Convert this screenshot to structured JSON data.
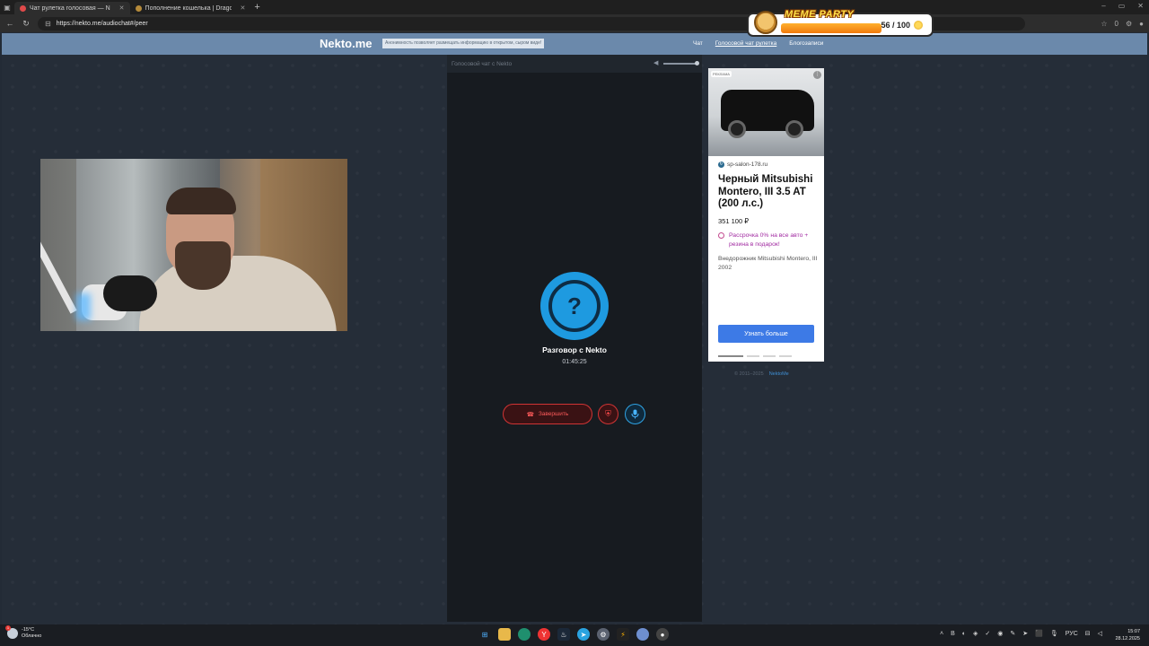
{
  "browser": {
    "tabs": [
      {
        "title": "Чат рулетка голосовая — N",
        "active": true,
        "favicon_color": "#e04a4a"
      },
      {
        "title": "Пополнение кошелька | Dragon",
        "active": false,
        "favicon_color": "#b58a3a"
      }
    ],
    "new_tab_icon": "plus-icon",
    "url": "https://nekto.me/audiochat#/peer",
    "reading_count": "0"
  },
  "overlay": {
    "title": "MEME PARTY",
    "count": "56 / 100"
  },
  "site": {
    "logo": "Nekto.me",
    "slogan": "Анонимность позволяет размещать информацию в открытом, сыром виде!",
    "nav": [
      {
        "label": "Чат",
        "current": false
      },
      {
        "label": "Голосовой чат рулетка",
        "current": true
      },
      {
        "label": "Блогозаписи",
        "current": false
      }
    ]
  },
  "chat": {
    "header": "Голосовой чат с Nekto",
    "avatar_symbol": "?",
    "title": "Разговор с Nekto",
    "timer": "01:45:25",
    "end_label": "Завершить",
    "colors": {
      "accent": "#1e9ae0",
      "danger": "#d03434"
    }
  },
  "ad": {
    "badge": "РЕКЛАМА",
    "domain": "sp-salon-178.ru",
    "title": "Черный Mitsubishi Montero, III 3.5 AT (200 л.с.)",
    "price": "351 100 ₽",
    "promo": "Рассрочка 0% на все авто + резина в подарок!",
    "description": "Внедорожник Mitsubishi Montero, III 2002",
    "button": "Узнать больше"
  },
  "footer": {
    "copyright": "© 2011–2025",
    "link": "NektoMe"
  },
  "taskbar": {
    "weather_temp": "-15°C",
    "weather_desc": "Облачно",
    "weather_badge": "1",
    "language": "РУС",
    "time": "15:07",
    "date": "28.12.2025"
  }
}
